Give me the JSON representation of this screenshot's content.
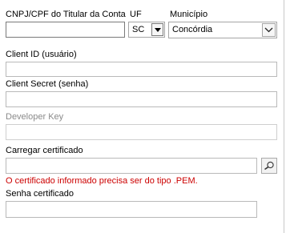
{
  "titular": {
    "label": "CNPJ/CPF do Titular da Conta",
    "value": ""
  },
  "uf": {
    "label": "UF",
    "value": "SC"
  },
  "municipio": {
    "label": "Município",
    "value": "Concórdia"
  },
  "client_id": {
    "label": "Client ID (usuário)",
    "value": ""
  },
  "client_secret": {
    "label": "Client Secret (senha)",
    "value": ""
  },
  "developer_key": {
    "label": "Developer Key",
    "value": ""
  },
  "certificado": {
    "label": "Carregar certificado",
    "value": "",
    "error": "O certificado informado precisa ser do tipo .PEM.",
    "browse_icon": "magnifier-icon"
  },
  "senha_certificado": {
    "label": "Senha certificado",
    "value": ""
  }
}
